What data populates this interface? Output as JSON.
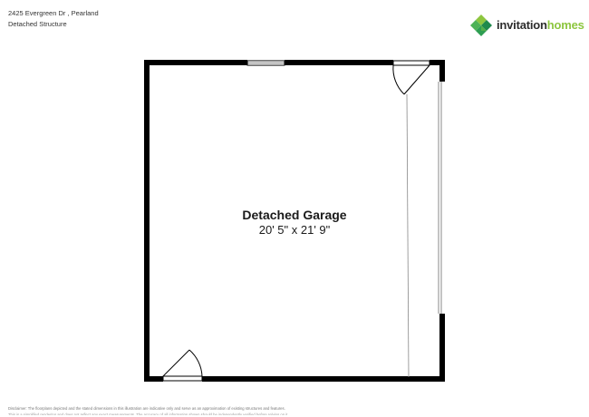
{
  "header": {
    "address": "2425 Evergreen Dr , Pearland",
    "subtitle": "Detached Structure"
  },
  "logo": {
    "word1": "invitation",
    "word2": "homes",
    "colors": {
      "mark_dark": "#1f8a4c",
      "mark_mid": "#4db257",
      "mark_light": "#8dc63f",
      "text_dark": "#2d2d2d",
      "text_green": "#8dc63f"
    }
  },
  "floorplan": {
    "room": {
      "name": "Detached Garage",
      "dimensions": "20' 5\" x 21' 9\""
    },
    "colors": {
      "wall": "#000000",
      "opening_line": "#888888"
    }
  },
  "footer": {
    "disclaimer": "Disclaimer: The floorplans depicted and the stated dimensions in this illustration are indicative only and serve as an approximation of existing structures and features.",
    "disclaimer_cut": "This is a simplified rendering and does not reflect any exact measurements. The accuracy of all information shown should be independently verified before relying on it."
  }
}
